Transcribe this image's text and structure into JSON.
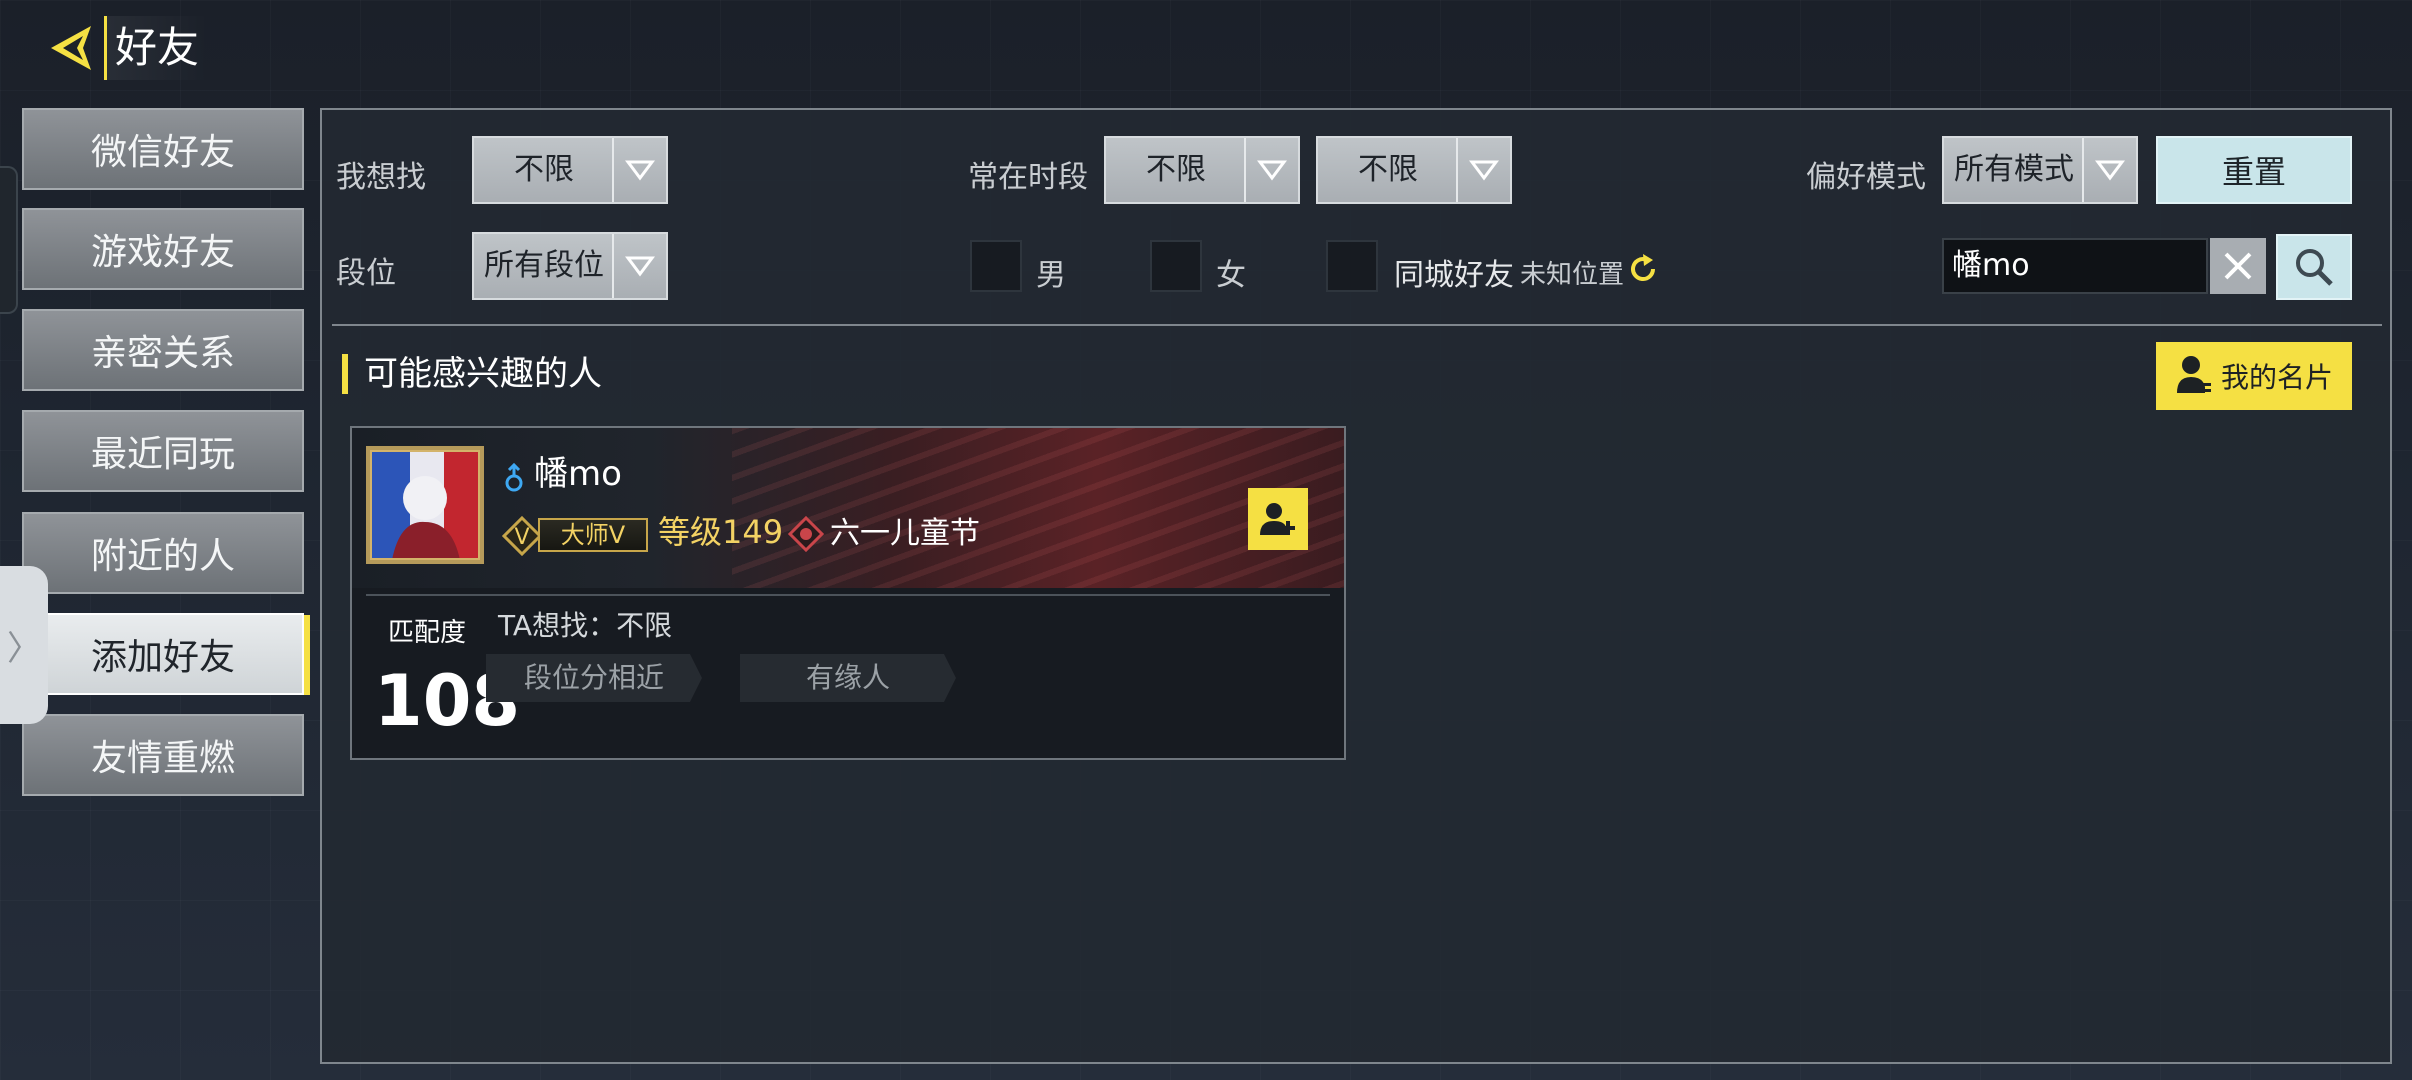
{
  "header": {
    "title": "好友"
  },
  "sidebar": {
    "items": [
      {
        "label": "微信好友",
        "active": false
      },
      {
        "label": "游戏好友",
        "active": false
      },
      {
        "label": "亲密关系",
        "active": false
      },
      {
        "label": "最近同玩",
        "active": false
      },
      {
        "label": "附近的人",
        "active": false
      },
      {
        "label": "添加好友",
        "active": true
      },
      {
        "label": "友情重燃",
        "active": false
      }
    ],
    "handle_glyph": "〉"
  },
  "filters": {
    "looking_for": {
      "label": "我想找",
      "value": "不限"
    },
    "active_time": {
      "label": "常在时段",
      "from": "不限",
      "to": "不限"
    },
    "preferred_mode": {
      "label": "偏好模式",
      "value": "所有模式"
    },
    "reset_label": "重置",
    "rank": {
      "label": "段位",
      "value": "所有段位"
    },
    "male_label": "男",
    "female_label": "女",
    "same_city_label": "同城好友",
    "location_status": "未知位置",
    "search_value": "幡mo"
  },
  "section": {
    "title": "可能感兴趣的人",
    "my_card_label": "我的名片"
  },
  "player": {
    "name": "幡mo",
    "gender": "male",
    "rank": "大师Ⅴ",
    "rank_numeral": "Ⅴ",
    "level": "等级149",
    "event": "六一儿童节",
    "match_label": "匹配度",
    "match_score": "108",
    "wants_label": "TA想找：不限",
    "tags": [
      "段位分相近",
      "有缘人"
    ]
  },
  "colors": {
    "accent_yellow": "#f5e043",
    "gold": "#f3d264",
    "teal_button": "#c9e5ea",
    "male_blue": "#3ea8f2"
  }
}
